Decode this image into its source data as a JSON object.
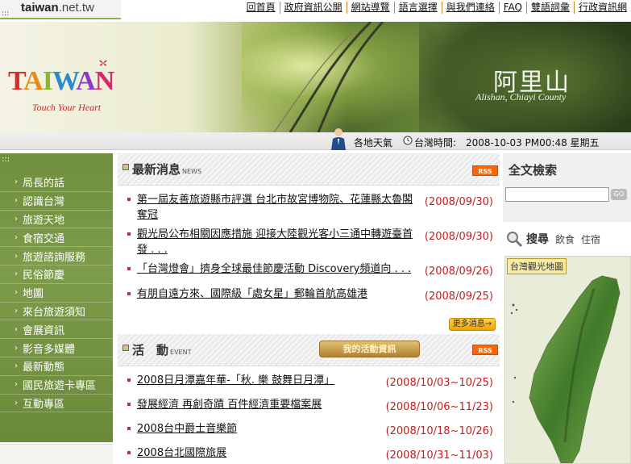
{
  "site": {
    "name": "taiwan",
    "tld": ".net.tw",
    "dots": ":::"
  },
  "topnav": [
    "回首頁",
    "政府資訊公開",
    "網站導覽",
    "語言選擇",
    "與我們連絡",
    "FAQ",
    "雙語詞彙",
    "行政資訊網"
  ],
  "banner": {
    "logo_letters": [
      "T",
      "A",
      "I",
      "W",
      "A",
      "N"
    ],
    "tagline": "Touch Your Heart",
    "title": "阿里山",
    "subtitle": "Alishan, Chiayi County"
  },
  "infostrip": {
    "weather": "各地天氣",
    "time_label": "台灣時間:",
    "time_value": "2008-10-03  PM00:48  星期五"
  },
  "sidebar": {
    "dots": ":::",
    "items": [
      "局長的話",
      "認識台灣",
      "旅遊天地",
      "食宿交通",
      "旅遊諮詢服務",
      "民俗節慶",
      "地圖",
      "來台旅遊須知",
      "會展資訊",
      "影音多媒體",
      "最新動態",
      "國民旅遊卡專區",
      "互動專區"
    ]
  },
  "news": {
    "title": "最新消息",
    "title_en": "NEWS",
    "rss": "RSS",
    "more": "更多消息→",
    "items": [
      {
        "text": "第一屆友善旅遊縣市評選 台北市故宮博物院、花蓮縣太魯閣奪冠",
        "date": "(2008/09/30)"
      },
      {
        "text": "觀光局公布相關因應措施 迎接大陸觀光客小三通中轉遊臺首發 . . .",
        "date": "(2008/09/30)"
      },
      {
        "text": "「台灣燈會」擠身全球最佳節慶活動 Discovery頻道向 . . .",
        "date": "(2008/09/26)"
      },
      {
        "text": "有朋自遠方來、國際級「處女星」郵輪首航高雄港",
        "date": "(2008/09/25)"
      }
    ]
  },
  "events": {
    "title": "活　動",
    "title_en": "EVENT",
    "button": "我的活動資訊",
    "rss": "RSS",
    "items": [
      {
        "text": "2008日月潭嘉年華-「秋. 樂 鼓舞日月潭」",
        "date": "(2008/10/03~10/25)"
      },
      {
        "text": "發展經濟 再創奇蹟 百件經濟重要檔案展",
        "date": "(2008/10/06~11/23)"
      },
      {
        "text": "2008台中爵士音樂節",
        "date": "(2008/10/18~10/26)"
      },
      {
        "text": "2008台北國際旅展",
        "date": "(2008/10/31~11/03)"
      }
    ]
  },
  "right": {
    "search_title": "全文檢索",
    "go": "GO",
    "search_value": "",
    "search2_title": "搜尋",
    "search2_options": [
      "飲食",
      "住宿"
    ],
    "map_label": "台灣觀光地圖"
  }
}
